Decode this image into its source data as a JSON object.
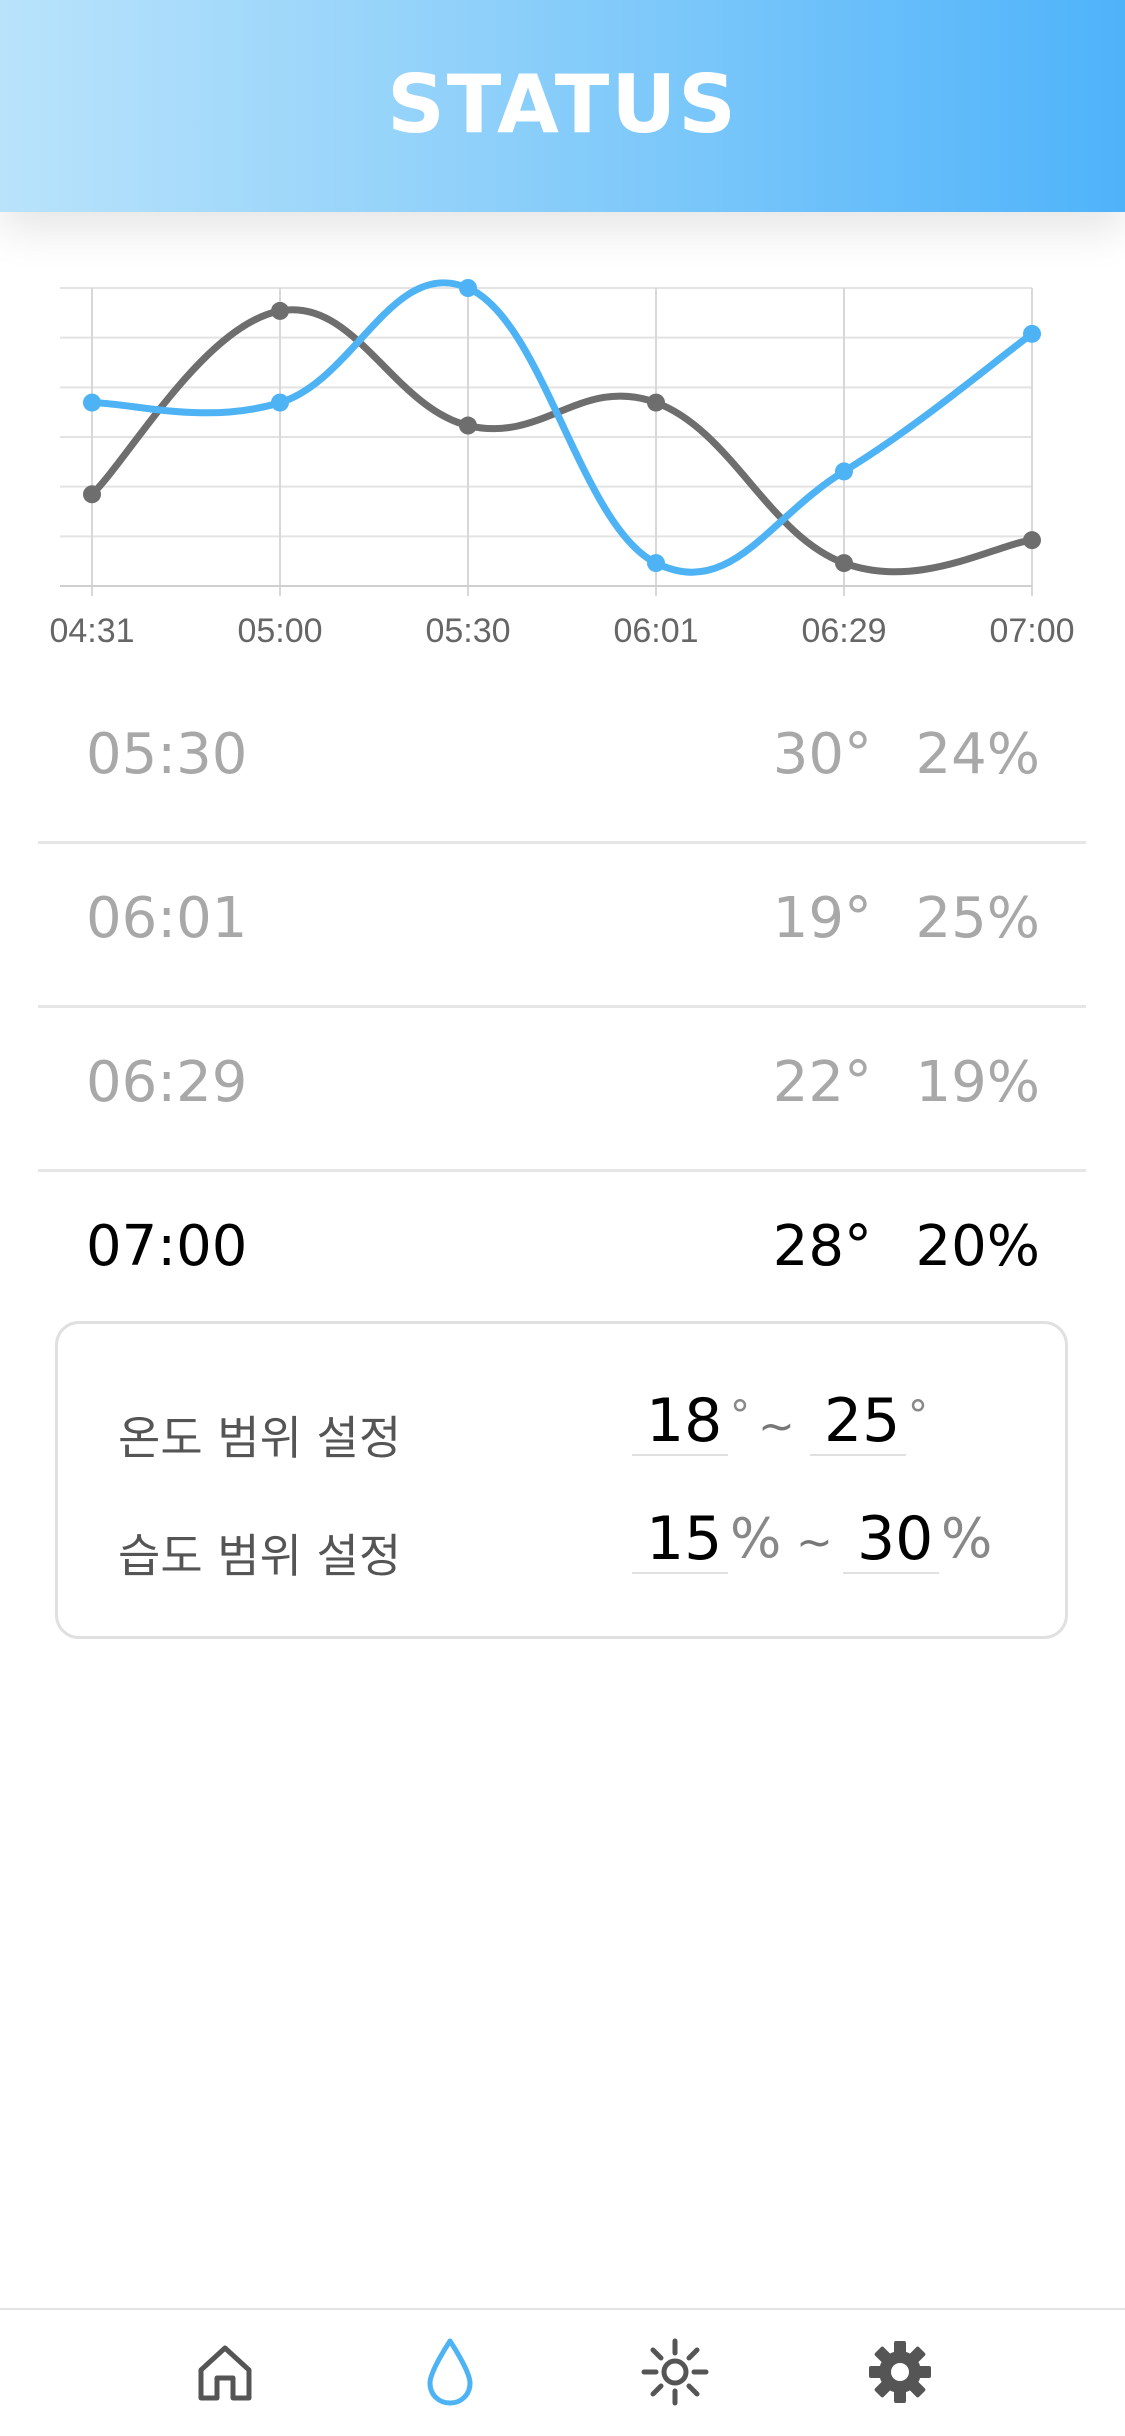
{
  "header": {
    "title": "STATUS"
  },
  "colors": {
    "accent": "#4db3f5",
    "series_gray": "#6e6e6e",
    "header_gradient_start": "#b9e3fb",
    "header_gradient_end": "#4fb3fa",
    "inactive_text": "#a8a8a8",
    "active_text": "#000000"
  },
  "chart_data": {
    "type": "line",
    "categories": [
      "04:31",
      "05:00",
      "05:30",
      "06:01",
      "06:29",
      "07:00"
    ],
    "series": [
      {
        "color": "#6e6e6e",
        "values": [
          28,
          36,
          31,
          32,
          25,
          26
        ]
      },
      {
        "color": "#4db3f5",
        "values": [
          32,
          32,
          37,
          25,
          29,
          35
        ]
      }
    ],
    "ylim": [
      24,
      37
    ],
    "grid": true,
    "curve": "smooth",
    "legend": "none"
  },
  "readings": [
    {
      "time": "05:30",
      "temp": "30°",
      "humidity": "24%",
      "current": false
    },
    {
      "time": "06:01",
      "temp": "19°",
      "humidity": "25%",
      "current": false
    },
    {
      "time": "06:29",
      "temp": "22°",
      "humidity": "19%",
      "current": false
    },
    {
      "time": "07:00",
      "temp": "28°",
      "humidity": "20%",
      "current": true
    }
  ],
  "settings": {
    "temperature": {
      "label": "온도 범위 설정",
      "min": "18",
      "max": "25",
      "unit": "°",
      "separator": "~"
    },
    "humidity": {
      "label": "습도 범위 설정",
      "min": "15",
      "max": "30",
      "unit": "%",
      "separator": "~"
    }
  },
  "tabs": [
    {
      "name": "home",
      "icon": "home-icon",
      "active": false
    },
    {
      "name": "humidity",
      "icon": "water-drop-icon",
      "active": true
    },
    {
      "name": "light",
      "icon": "sun-icon",
      "active": false
    },
    {
      "name": "settings",
      "icon": "gear-icon",
      "active": false
    }
  ]
}
